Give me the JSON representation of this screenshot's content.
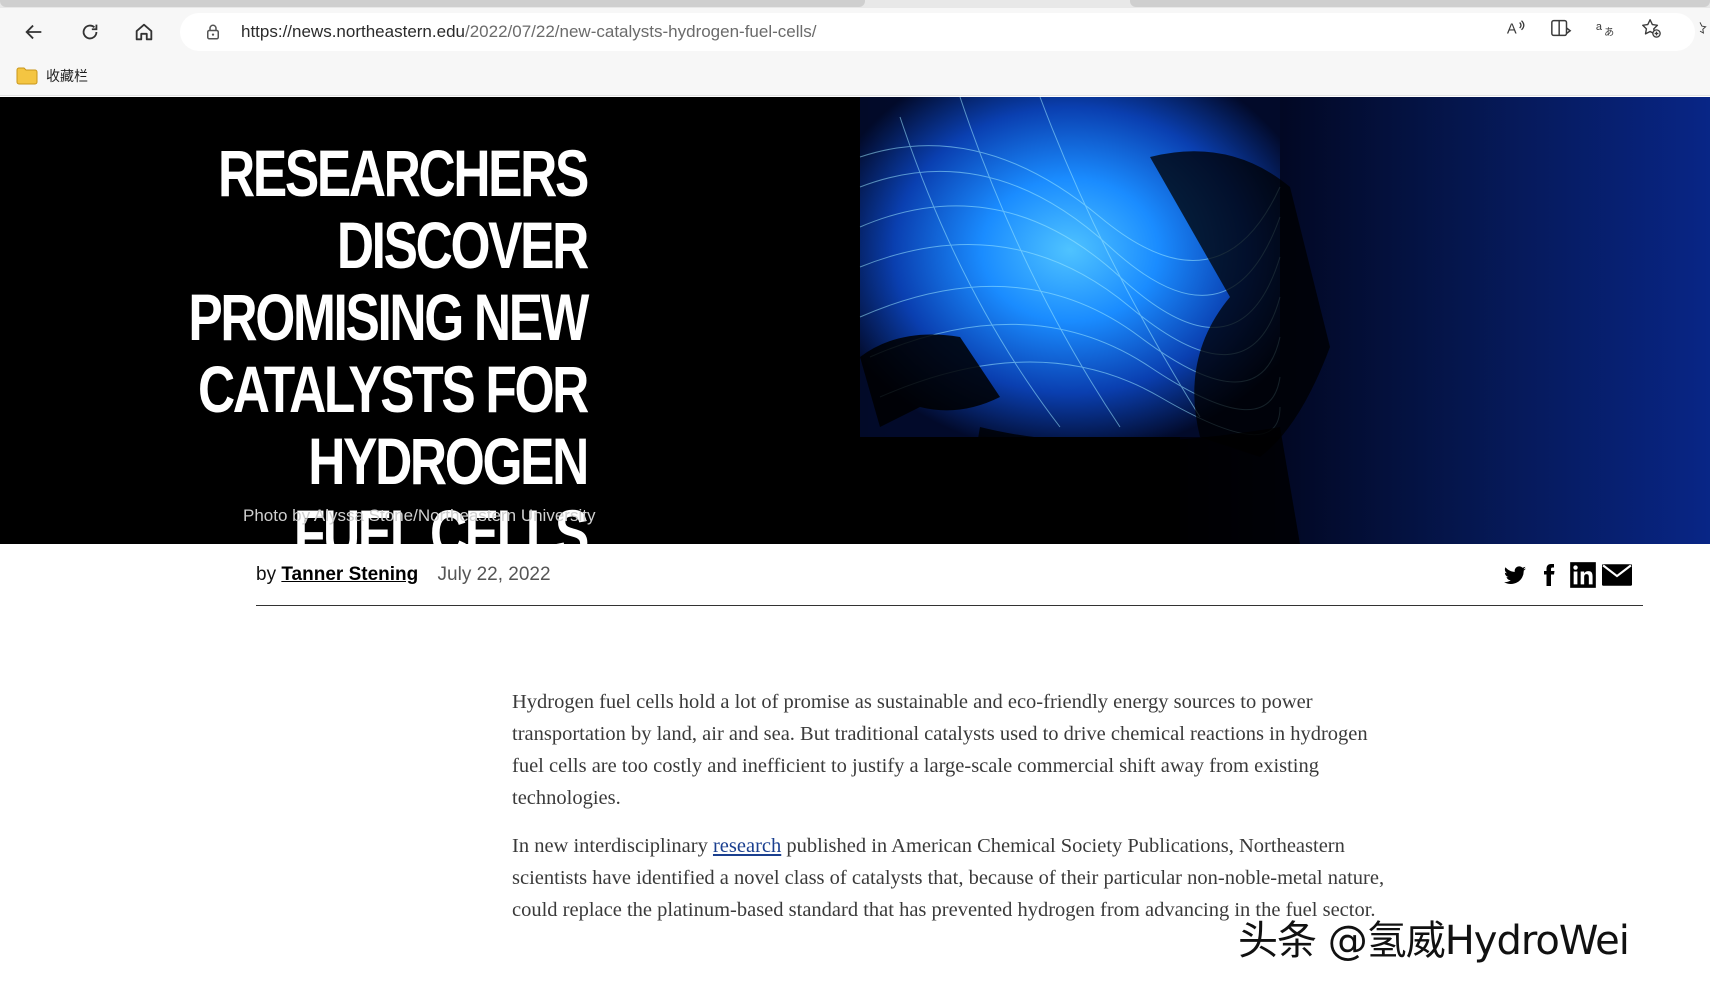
{
  "browser": {
    "url_host": "https://news.northeastern.edu",
    "url_path": "/2022/07/22/new-catalysts-hydrogen-fuel-cells/",
    "back_icon": "back-arrow-icon",
    "refresh_icon": "refresh-icon",
    "home_icon": "home-icon",
    "lock_icon": "lock-icon",
    "toolbar_icons": [
      "read-aloud-icon",
      "immersive-reader-icon",
      "translate-icon",
      "add-favorite-icon"
    ],
    "favorites_folder_label": "收藏栏"
  },
  "hero": {
    "headline_lines": [
      "RESEARCHERS DISCOVER",
      "PROMISING NEW",
      "CATALYSTS FOR HYDROGEN",
      "FUEL CELLS"
    ],
    "photo_credit": "Photo by Alyssa Stone/Northeastern University"
  },
  "byline": {
    "prefix": "by",
    "author": "Tanner Stening",
    "date": "July 22, 2022",
    "share_icons": [
      "twitter-icon",
      "facebook-icon",
      "linkedin-icon",
      "email-icon"
    ]
  },
  "article": {
    "p1": "Hydrogen fuel cells hold a lot of promise as sustainable and eco-friendly energy sources to power transportation by land, air and sea. But traditional catalysts used to drive chemical reactions in hydrogen fuel cells are too costly and inefficient to justify a large-scale commercial shift away from existing technologies.",
    "p2_before": "In new interdisciplinary ",
    "p2_link": "research",
    "p2_after": " published in American Chemical Society Publications, Northeastern scientists have identified a novel class of catalysts that, because of their particular non-noble-metal nature, could replace the platinum-based standard that has prevented hydrogen from advancing in the fuel sector."
  },
  "watermark": "头条 @氢威HydroWei",
  "colors": {
    "hero_bg": "#000000",
    "hero_glow": "#1a8cff",
    "link": "#1a3f8f",
    "body_text": "#3a3a3a"
  }
}
